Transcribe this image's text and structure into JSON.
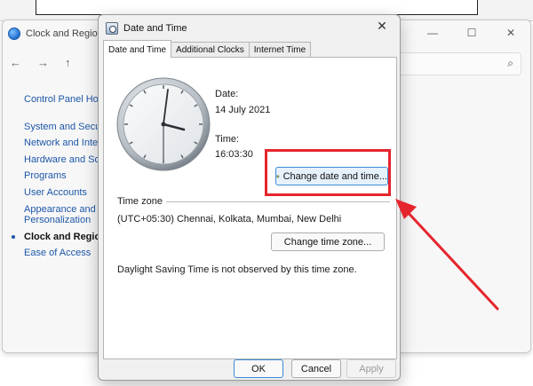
{
  "bg_window": {
    "title": "Clock and Region",
    "nav": {
      "back": "←",
      "forward": "→",
      "up": "↑"
    },
    "controls": {
      "minimize": "—",
      "maximize": "☐",
      "close": "✕"
    },
    "search_icon": "⌕",
    "sidebar": [
      {
        "label": "Control Panel Home"
      },
      {
        "label": "System and Security"
      },
      {
        "label": "Network and Internet"
      },
      {
        "label": "Hardware and Sound"
      },
      {
        "label": "Programs"
      },
      {
        "label": "User Accounts"
      },
      {
        "label": "Appearance and Personalization"
      },
      {
        "label": "Clock and Region"
      },
      {
        "label": "Ease of Access"
      }
    ]
  },
  "dialog": {
    "title": "Date and Time",
    "close": "✕",
    "tabs": [
      {
        "label": "Date and Time"
      },
      {
        "label": "Additional Clocks"
      },
      {
        "label": "Internet Time"
      }
    ],
    "date_label": "Date:",
    "date_value": "14 July 2021",
    "time_label": "Time:",
    "time_value": "16:03:30",
    "change_date_button": "Change date and time...",
    "time_zone_heading": "Time zone",
    "time_zone_value": "(UTC+05:30) Chennai, Kolkata, Mumbai, New Delhi",
    "change_time_zone_button": "Change time zone...",
    "dst_text": "Daylight Saving Time is not observed by this time zone.",
    "ok_button": "OK",
    "cancel_button": "Cancel",
    "apply_button": "Apply"
  },
  "colors": {
    "annotation_red": "#e5252d",
    "link_blue": "#1d57a8",
    "accent_blue": "#3e8ad6"
  }
}
